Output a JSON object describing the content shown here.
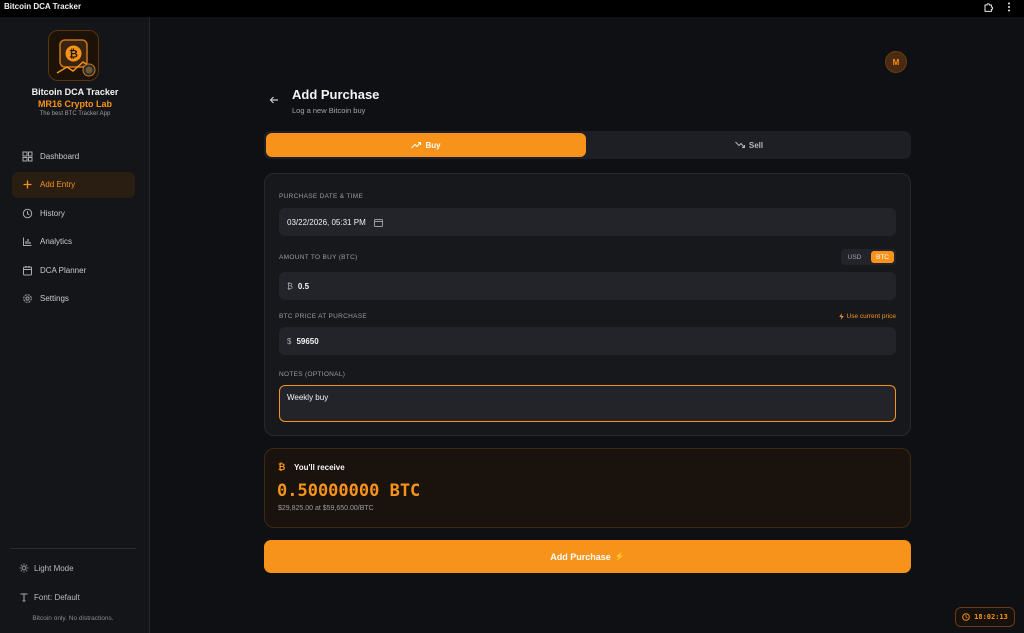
{
  "window": {
    "title": "Bitcoin DCA Tracker",
    "icons": [
      "extension-icon",
      "more-vert-icon"
    ]
  },
  "sidebar": {
    "app_name": "Bitcoin DCA Tracker",
    "lab_name": "MR16 Crypto Lab",
    "tagline": "The best BTC Tracker App",
    "items": [
      {
        "label": "Dashboard",
        "icon": "dashboard-icon",
        "active": false
      },
      {
        "label": "Add Entry",
        "icon": "plus-icon",
        "active": true
      },
      {
        "label": "History",
        "icon": "history-icon",
        "active": false
      },
      {
        "label": "Analytics",
        "icon": "bar-chart-icon",
        "active": false
      },
      {
        "label": "DCA Planner",
        "icon": "calendar-icon",
        "active": false
      },
      {
        "label": "Settings",
        "icon": "gear-icon",
        "active": false
      }
    ],
    "light_mode_label": "Light Mode",
    "font_label": "Font: Default",
    "footer": "Bitcoin only. No distractions."
  },
  "header": {
    "avatar_initial": "M",
    "title": "Add Purchase",
    "subtitle": "Log a new Bitcoin buy"
  },
  "type_toggle": {
    "buy_label": "Buy",
    "sell_label": "Sell",
    "selected": "Buy"
  },
  "form": {
    "date_label": "PURCHASE DATE & TIME",
    "date_value": "03/22/2026, 05:31 PM",
    "amount_label": "AMOUNT TO BUY (BTC)",
    "unit_usd": "USD",
    "unit_btc": "BTC",
    "unit_selected": "BTC",
    "amount_prefix": "₿",
    "amount_value": "0.5",
    "price_label": "BTC PRICE AT PURCHASE",
    "use_current_price": "Use current price",
    "price_prefix": "$",
    "price_value": "59650",
    "notes_label": "NOTES (OPTIONAL)",
    "notes_value": "Weekly buy"
  },
  "summary": {
    "heading": "You'll receive",
    "amount": "0.50000000 BTC",
    "detail": "$29,825.00 at $59,650.00/BTC"
  },
  "submit_label": "Add Purchase",
  "clock": "18:02:13",
  "colors": {
    "accent": "#f7931a",
    "background": "#0f1013",
    "sidebar": "#141518",
    "card": "#17181c"
  }
}
